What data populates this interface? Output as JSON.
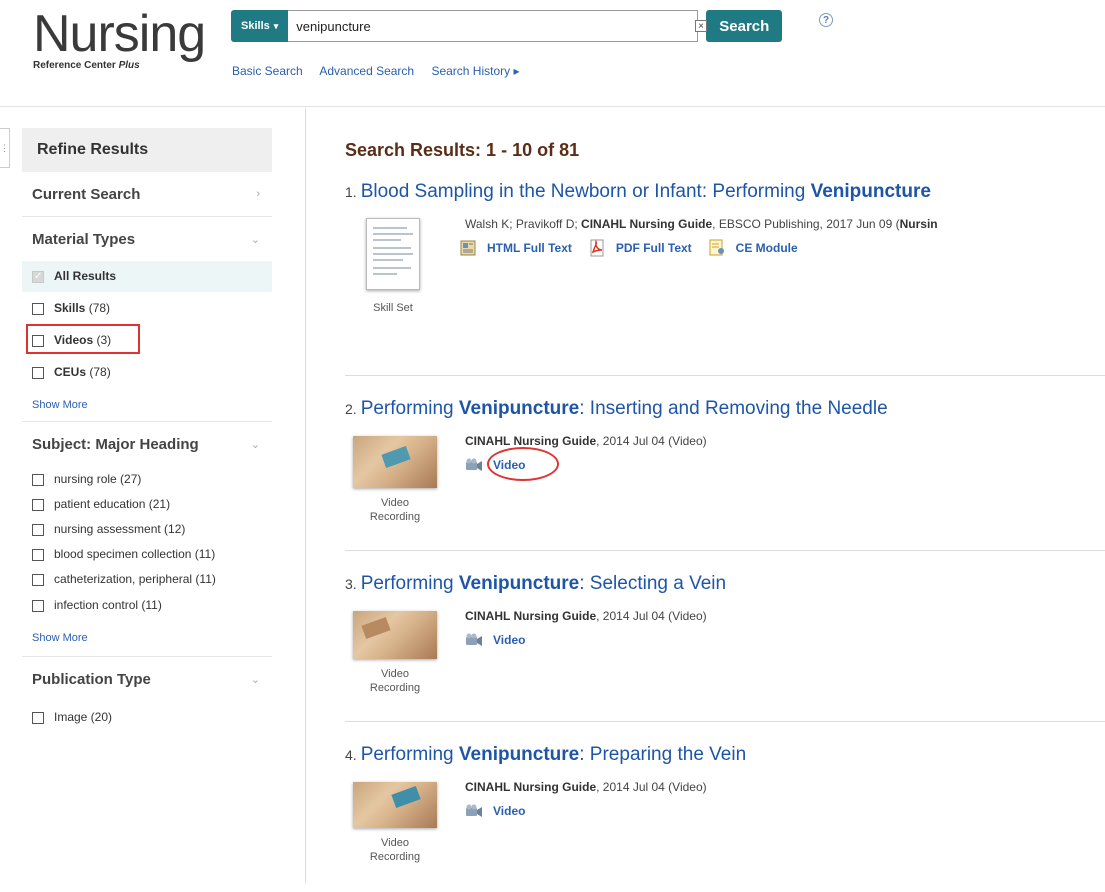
{
  "logo": {
    "main": "Nursing",
    "sub_prefix": "Reference Center ",
    "sub_suffix": "Plus"
  },
  "search": {
    "field_label": "Skills",
    "query": "venipuncture",
    "clear_symbol": "×",
    "button_label": "Search",
    "help_symbol": "?"
  },
  "search_links": [
    "Basic Search",
    "Advanced Search",
    "Search History ▸"
  ],
  "sidebar": {
    "title": "Refine Results",
    "current_search": "Current Search",
    "material_types": {
      "title": "Material Types",
      "items": [
        {
          "label": "All Results",
          "count": ""
        },
        {
          "label": "Skills",
          "count": "(78)"
        },
        {
          "label": "Videos",
          "count": "(3)"
        },
        {
          "label": "CEUs",
          "count": "(78)"
        }
      ],
      "show_more": "Show More"
    },
    "subject": {
      "title": "Subject: Major Heading",
      "items": [
        "nursing role (27)",
        "patient education (21)",
        "nursing assessment (12)",
        "blood specimen collection (11)",
        "catheterization, peripheral (11)",
        "infection control (11)"
      ],
      "show_more": "Show More"
    },
    "publication_type": {
      "title": "Publication Type",
      "items": [
        "Image (20)"
      ]
    }
  },
  "results": {
    "heading": "Search Results: 1 - 10 of 81",
    "items": [
      {
        "num": "1.",
        "title_pre": "Blood Sampling in the Newborn or Infant: Performing ",
        "title_bold": "Venipuncture",
        "title_post": "",
        "meta_pre": "Walsh K; Pravikoff D; ",
        "meta_bold": "CINAHL Nursing Guide",
        "meta_post": ", EBSCO Publishing, 2017 Jun 09 (",
        "meta_bold2": "Nursin",
        "thumb_caption": "Skill Set",
        "links": [
          "HTML Full Text",
          "PDF Full Text",
          "CE Module"
        ]
      },
      {
        "num": "2.",
        "title_pre": "Performing ",
        "title_bold": "Venipuncture",
        "title_post": ": Inserting and Removing the Needle",
        "meta_bold": "CINAHL Nursing Guide",
        "meta_post": ", 2014 Jul 04 (Video)",
        "thumb_caption": "Video Recording",
        "links": [
          "Video"
        ]
      },
      {
        "num": "3.",
        "title_pre": "Performing ",
        "title_bold": "Venipuncture",
        "title_post": ": Selecting a Vein",
        "meta_bold": "CINAHL Nursing Guide",
        "meta_post": ", 2014 Jul 04 (Video)",
        "thumb_caption": "Video Recording",
        "links": [
          "Video"
        ]
      },
      {
        "num": "4.",
        "title_pre": "Performing ",
        "title_bold": "Venipuncture",
        "title_post": ": Preparing the Vein",
        "meta_bold": "CINAHL Nursing Guide",
        "meta_post": ", 2014 Jul 04 (Video)",
        "thumb_caption": "Video Recording",
        "links": [
          "Video"
        ]
      }
    ]
  },
  "colors": {
    "teal": "#1f7a83",
    "link": "#1e55a8",
    "highlight": "#dd3333",
    "heading": "#5a2d16"
  }
}
